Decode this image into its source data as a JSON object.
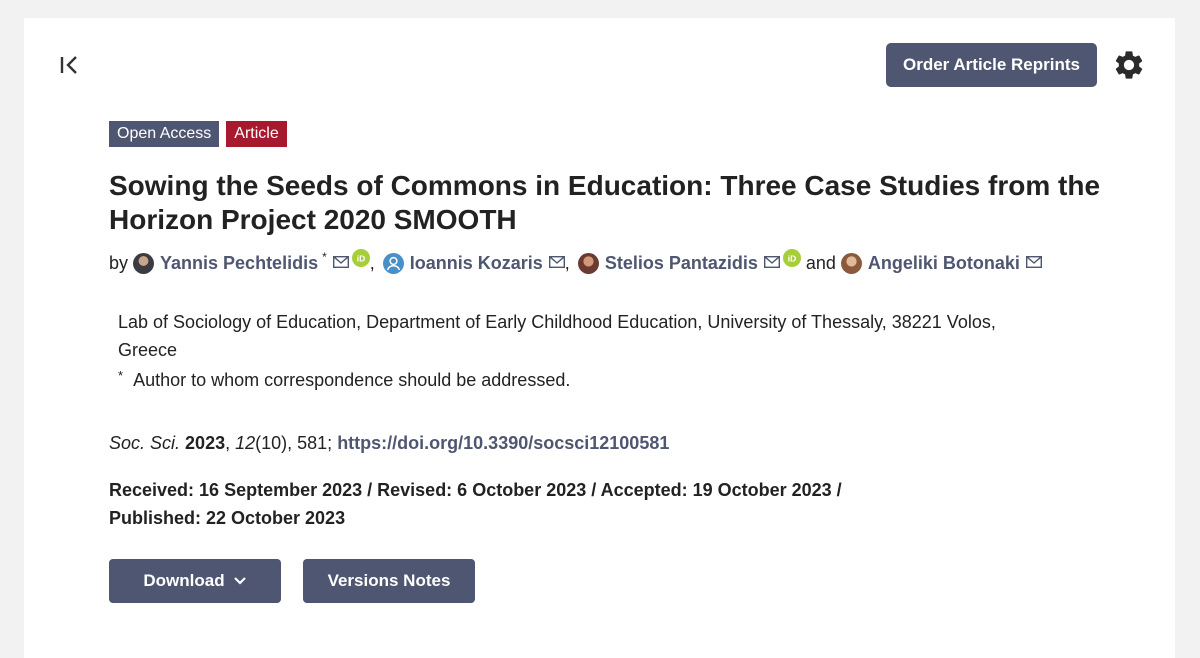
{
  "toolbar": {
    "reprints_label": "Order Article Reprints"
  },
  "badges": {
    "open_access": "Open Access",
    "article_type": "Article"
  },
  "article": {
    "title": "Sowing the Seeds of Commons in Education: Three Case Studies from the Horizon Project 2020 SMOOTH",
    "by_label": "by",
    "authors": [
      {
        "name": "Yannis Pechtelidis",
        "corresponding_mark": "*"
      },
      {
        "name": "Ioannis Kozaris"
      },
      {
        "name": "Stelios Pantazidis"
      },
      {
        "name": "Angeliki Botonaki"
      }
    ],
    "author_separator": ",",
    "author_conjunction": "and",
    "affiliation": "Lab of Sociology of Education, Department of Early Childhood Education, University of Thessaly, 38221 Volos, Greece",
    "correspondence_mark": "*",
    "correspondence_note": "Author to whom correspondence should be addressed.",
    "citation": {
      "journal": "Soc. Sci.",
      "year": "2023",
      "sep1": ", ",
      "volume": "12",
      "issue_pages": "(10), 581; ",
      "doi": "https://doi.org/10.3390/socsci12100581"
    },
    "dates_line1": "Received: 16 September 2023 / Revised: 6 October 2023 / Accepted: 19 October 2023 /",
    "dates_line2": "Published: 22 October 2023"
  },
  "actions": {
    "download_label": "Download",
    "versions_label": "Versions Notes"
  },
  "colors": {
    "accent": "#4f5671",
    "article_badge": "#a7192f",
    "orcid": "#a6ce39"
  },
  "icons": [
    "collapse-sidebar-icon",
    "gear-icon",
    "mail-icon",
    "orcid-icon",
    "user-icon",
    "chevron-down-icon"
  ]
}
